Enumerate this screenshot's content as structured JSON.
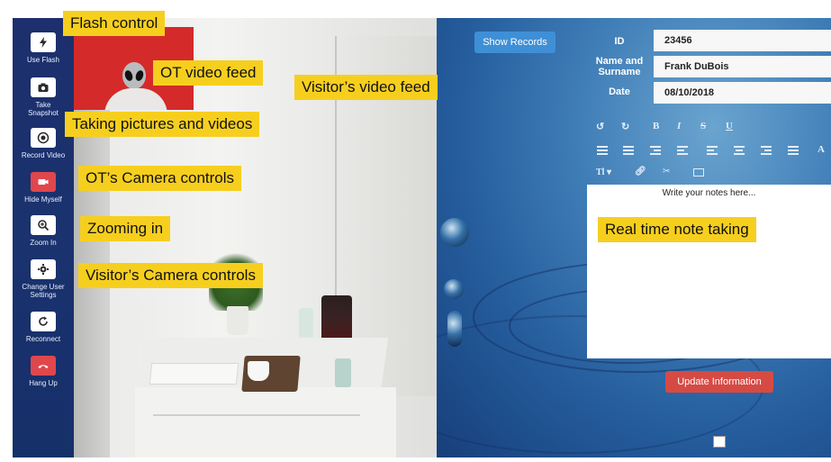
{
  "sidebar": {
    "items": [
      {
        "label": "Use Flash",
        "icon": "flash-icon"
      },
      {
        "label": "Take Snapshot",
        "icon": "camera-icon"
      },
      {
        "label": "Record Video",
        "icon": "record-icon"
      },
      {
        "label": "Hide Myself",
        "icon": "video-camera-icon"
      },
      {
        "label": "Zoom In",
        "icon": "zoom-in-icon"
      },
      {
        "label": "Change User Settings",
        "icon": "gear-icon"
      },
      {
        "label": "Reconnect",
        "icon": "refresh-icon"
      },
      {
        "label": "Hang Up",
        "icon": "phone-icon"
      }
    ]
  },
  "records": {
    "show_label": "Show Records"
  },
  "form": {
    "id_label": "ID",
    "id_value": "23456",
    "name_label": "Name and Surname",
    "name_value": "Frank DuBois",
    "date_label": "Date",
    "date_value": "08/10/2018"
  },
  "notes": {
    "placeholder": "Write your notes here..."
  },
  "update": {
    "label": "Update Information"
  },
  "annotations": {
    "flash": "Flash control",
    "ot_feed": "OT video feed",
    "visitor_feed": "Visitor’s video feed",
    "pictures": "Taking pictures and videos",
    "ot_controls": "OT’s Camera controls",
    "zoom": "Zooming in",
    "visitor_controls": "Visitor’s Camera controls",
    "notes": "Real time note taking"
  },
  "colors": {
    "accent_blue": "#3f8fd6",
    "danger_red": "#d64a44",
    "sidebar": "#1d2f6d",
    "callout": "#f6cf1e"
  }
}
